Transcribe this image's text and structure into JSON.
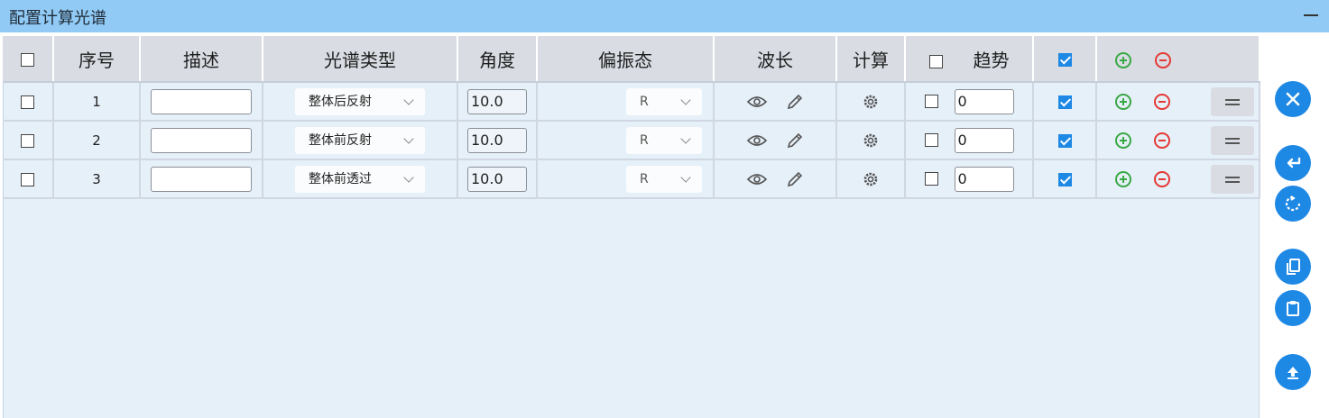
{
  "window": {
    "title": "配置计算光谱"
  },
  "table": {
    "headers": {
      "index": "序号",
      "description": "描述",
      "spectrum_type": "光谱类型",
      "angle": "角度",
      "polarization": "偏振态",
      "wavelength": "波长",
      "compute": "计算",
      "trend": "趋势"
    },
    "rows": [
      {
        "index": "1",
        "description": "",
        "spectrum_type": "整体后反射",
        "angle": "10.0",
        "polarization": "R",
        "trend": "0",
        "trend_checked": false,
        "enabled": true
      },
      {
        "index": "2",
        "description": "",
        "spectrum_type": "整体前反射",
        "angle": "10.0",
        "polarization": "R",
        "trend": "0",
        "trend_checked": false,
        "enabled": true
      },
      {
        "index": "3",
        "description": "",
        "spectrum_type": "整体前透过",
        "angle": "10.0",
        "polarization": "R",
        "trend": "0",
        "trend_checked": false,
        "enabled": true
      }
    ]
  },
  "side_buttons": [
    "close-icon",
    "enter-icon",
    "refresh-icon",
    "copy-icon",
    "paste-icon",
    "upload-icon"
  ],
  "colors": {
    "title_bar": "#90caf5",
    "accent": "#1e88e5",
    "add": "#3aa845",
    "remove": "#e53935"
  }
}
